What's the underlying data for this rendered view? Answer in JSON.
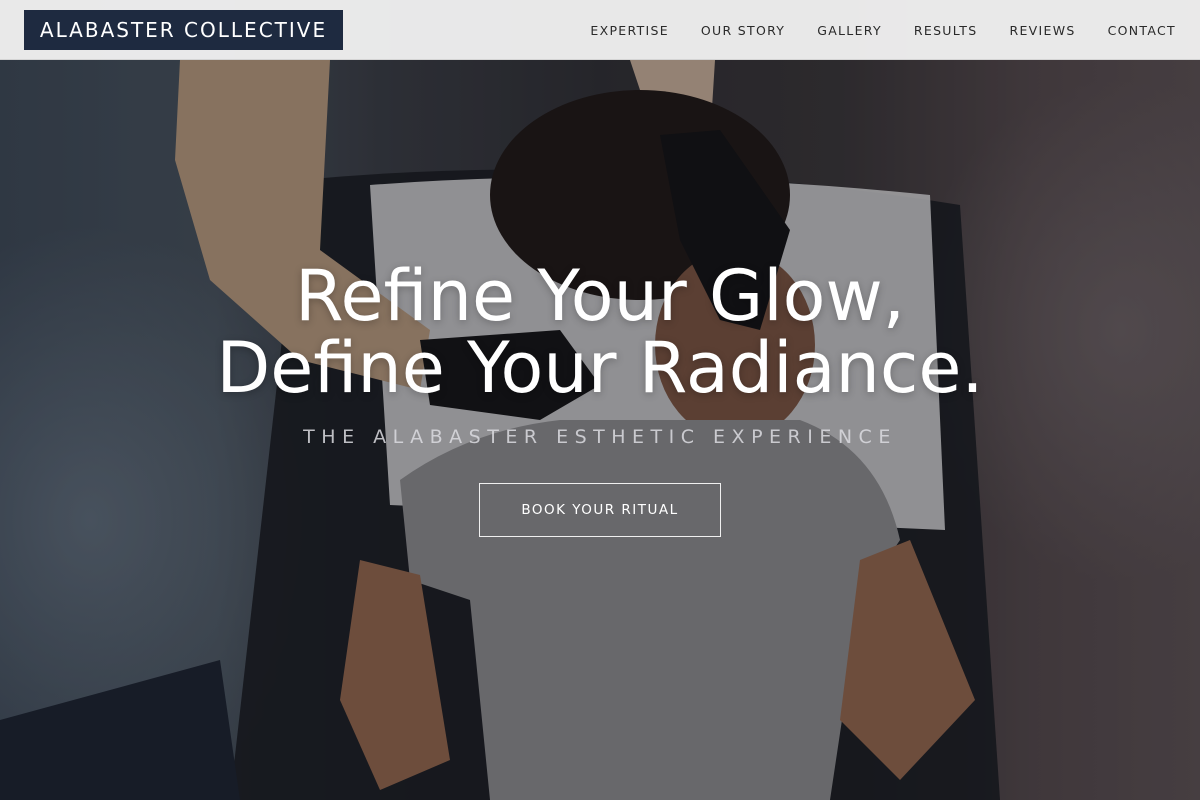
{
  "header": {
    "brand": "ALABASTER COLLECTIVE",
    "nav": [
      {
        "label": "EXPERTISE"
      },
      {
        "label": "OUR STORY"
      },
      {
        "label": "GALLERY"
      },
      {
        "label": "RESULTS"
      },
      {
        "label": "REVIEWS"
      },
      {
        "label": "CONTACT"
      }
    ]
  },
  "hero": {
    "headline_line1": "Refine Your Glow,",
    "headline_line2": "Define Your Radiance.",
    "tagline": "THE ALABASTER ESTHETIC EXPERIENCE",
    "cta_label": "BOOK YOUR RITUAL",
    "background_image": "esthetician-treatment-photo"
  },
  "colors": {
    "brand_bg": "#1e2a40",
    "header_bg": "#f0f0f0",
    "nav_text": "#2a2a2a",
    "hero_text": "#ffffff"
  }
}
